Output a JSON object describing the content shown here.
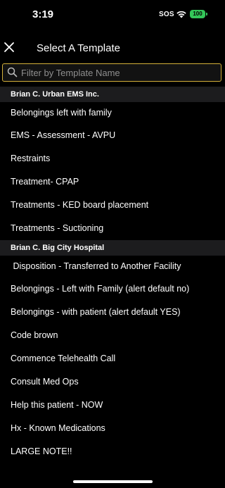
{
  "status": {
    "time": "3:19",
    "sos": "SOS",
    "battery": "100"
  },
  "header": {
    "title": "Select A Template"
  },
  "search": {
    "placeholder": "Filter by Template Name"
  },
  "groups": [
    {
      "name": "Brian C. Urban EMS Inc.",
      "items": [
        "Belongings left with family",
        "EMS - Assessment - AVPU",
        "Restraints",
        "Treatment- CPAP",
        "Treatments - KED board placement",
        "Treatments - Suctioning"
      ]
    },
    {
      "name": "Brian C. Big City Hospital",
      "items": [
        " Disposition - Transferred to Another Facility",
        "Belongings - Left with Family (alert default no)",
        "Belongings - with patient (alert default YES)",
        "Code brown",
        "Commence Telehealth Call",
        "Consult Med Ops",
        "Help this patient - NOW",
        "Hx - Known Medications",
        "LARGE NOTE!!"
      ]
    }
  ],
  "colors": {
    "accent": "#d4b13a",
    "battery": "#34c759",
    "group_bg": "#1c1c1e"
  }
}
